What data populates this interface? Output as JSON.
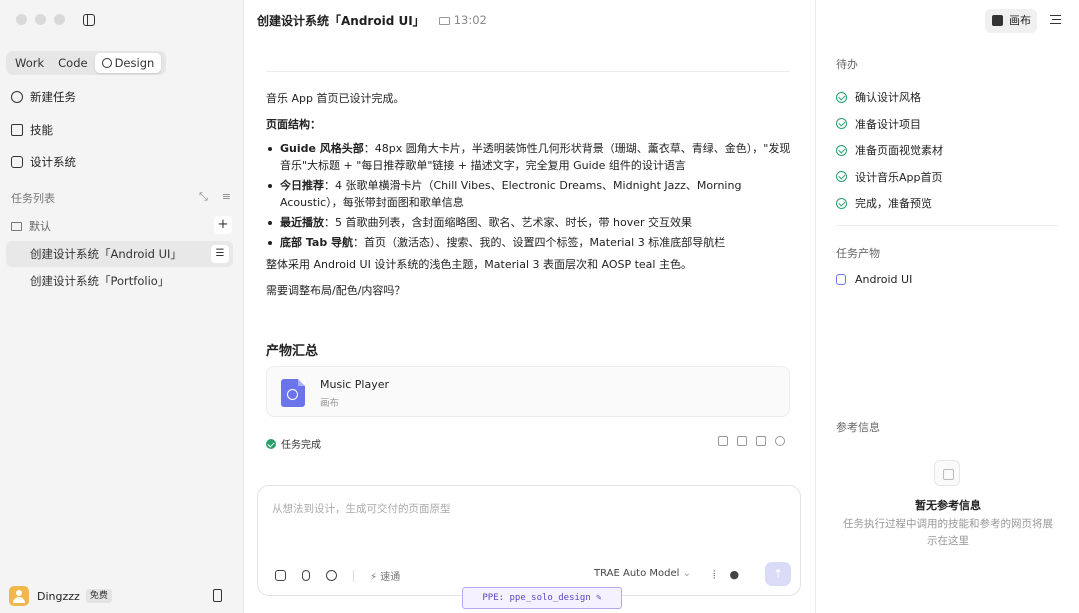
{
  "sidebar": {
    "modes": [
      "Work",
      "Code",
      "Design"
    ],
    "nav": [
      "新建任务",
      "技能",
      "设计系统"
    ],
    "task_list_title": "任务列表",
    "folder": "默认",
    "folder_add": "+",
    "tasks": [
      "创建设计系统「Android UI」",
      "创建设计系统「Portfolio」"
    ],
    "user": {
      "name": "Dingzzz",
      "badge": "免费"
    }
  },
  "header": {
    "title": "创建设计系统「Android UI」",
    "time": "13:02"
  },
  "chat": {
    "intro": "音乐 App 首页已设计完成。",
    "structure_title": "页面结构：",
    "bullets": [
      {
        "bold": "Guide 风格头部",
        "text": "：48px 圆角大卡片，半透明装饰性几何形状背景（珊瑚、薰衣草、青绿、金色），\"发现音乐\"大标题 + \"每日推荐歌单\"链接 + 描述文字，完全复用 Guide 组件的设计语言"
      },
      {
        "bold": "今日推荐",
        "text": "：4 张歌单横滑卡片（Chill Vibes、Electronic Dreams、Midnight Jazz、Morning Acoustic），每张带封面图和歌单信息"
      },
      {
        "bold": "最近播放",
        "text": "：5 首歌曲列表，含封面缩略图、歌名、艺术家、时长，带 hover 交互效果"
      },
      {
        "bold": "底部 Tab 导航",
        "text": "：首页（激活态）、搜索、我的、设置四个标签，Material 3 标准底部导航栏"
      }
    ],
    "summary": "整体采用 Android UI 设计系统的浅色主题，Material 3 表面层次和 AOSP teal 主色。",
    "question": "需要调整布局/配色/内容吗？",
    "artifact_title": "产物汇总",
    "artifact": {
      "name": "Music Player",
      "type": "画布"
    },
    "status": "任务完成"
  },
  "composer": {
    "placeholder": "从想法到设计，生成可交付的页面原型",
    "speed": "速通",
    "model": "TRAE Auto Model",
    "send": "↑"
  },
  "ppe_badge": "PPE: ppe_solo_design ✎",
  "right": {
    "canvas_button": "画布",
    "todo_title": "待办",
    "todos": [
      "确认设计风格",
      "准备设计项目",
      "准备页面视觉素材",
      "设计音乐App首页",
      "完成，准备预览"
    ],
    "products_title": "任务产物",
    "product": "Android UI",
    "ref_title": "参考信息",
    "empty_title": "暂无参考信息",
    "empty_desc": "任务执行过程中调用的技能和参考的网页将展示在这里"
  },
  "colors": {
    "success": "#27a06b",
    "accent": "#6b74e8",
    "ppe_border": "#b8a6f0"
  }
}
